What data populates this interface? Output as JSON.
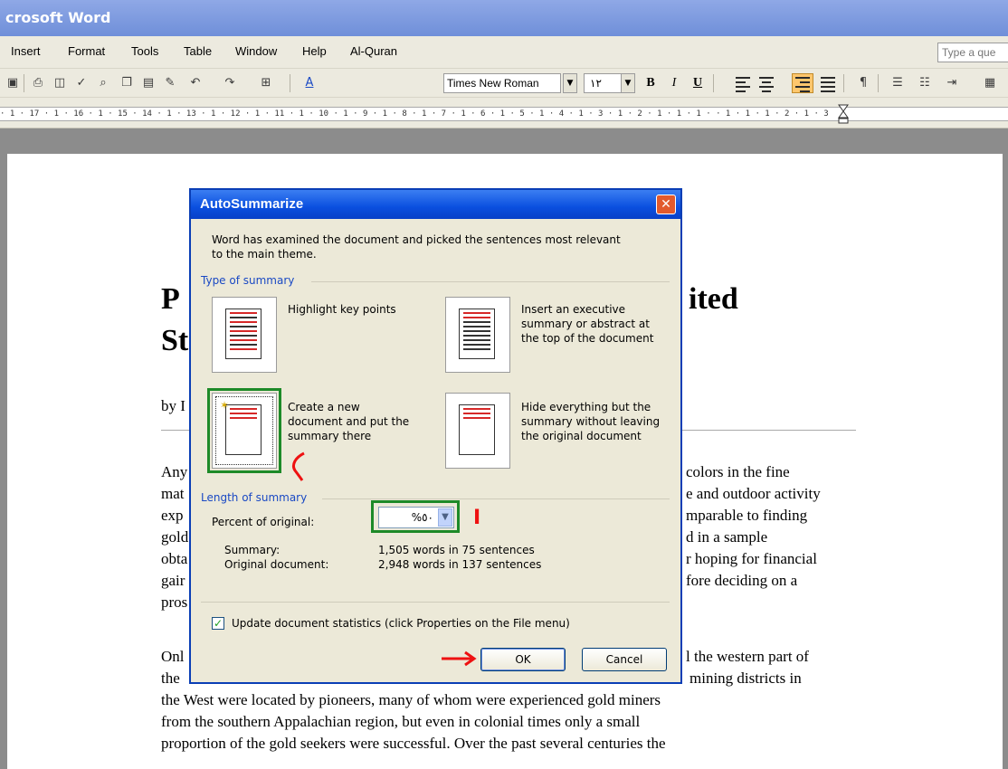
{
  "window": {
    "title": "crosoft Word"
  },
  "menu": {
    "items": [
      "Insert",
      "Format",
      "Tools",
      "Table",
      "Window",
      "Help",
      "Al-Quran"
    ],
    "help_box": "Type a que"
  },
  "toolbar": {
    "font_name": "Times New Roman",
    "font_size": "١٢",
    "bold": "B",
    "italic": "I",
    "underline": "U",
    "style_icon": "A"
  },
  "ruler": {
    "text": "· 1 · 17 · 1 · 16 · 1 · 15   · 14 · 1 · 13 · 1 · 12 · 1 · 11 · 1 · 10 · 1 · 9 · 1 · 8 · 1 · 7 · 1 · 6 · 1 · 5 · 1 · 4 · 1 · 3 · 1 · 2 · 1 · 1 · 1 ·    · 1 · 1 · 1 · 2 · 1 · 3"
  },
  "document": {
    "title_line1": "P",
    "title_line1_right": "ited",
    "title_line2": "St",
    "byline": "by I",
    "para1_left": [
      "Any",
      "mat",
      "exp",
      "gold",
      "obta",
      "gair",
      "pros"
    ],
    "para1_right": [
      "colors in the fine",
      "e and outdoor activity",
      "mparable to finding",
      "d in a sample",
      "r hoping for financial",
      "fore deciding on a"
    ],
    "para2_left": [
      "Onl",
      "the"
    ],
    "para2_right": [
      "l the western part of",
      "mining districts in"
    ],
    "para2_full": [
      "the West were located by pioneers, many of whom were experienced gold miners",
      "from the southern Appalachian region, but even in colonial times only a small",
      "proportion of the gold seekers were successful. Over the past several centuries the"
    ]
  },
  "dialog": {
    "title": "AutoSummarize",
    "intro": [
      "Word has examined the document and picked the sentences most relevant",
      "to the main theme."
    ],
    "type_group": "Type of summary",
    "options": {
      "highlight": "Highlight key points",
      "insert": [
        "Insert an executive",
        "summary or abstract at",
        "the top of the document"
      ],
      "create": [
        "Create a new",
        "document and put the",
        "summary there"
      ],
      "hide": [
        "Hide everything but the",
        "summary without leaving",
        "the original document"
      ]
    },
    "length_group": "Length of summary",
    "percent_label": "Percent of original:",
    "percent_value": "%٥٠",
    "summary_label": "Summary:",
    "summary_value": "1,505 words in 75 sentences",
    "original_label": "Original document:",
    "original_value": "2,948 words in 137 sentences",
    "checkbox_label": "Update document statistics (click Properties on the File menu)",
    "checkbox_checked": true,
    "ok_label": "OK",
    "cancel_label": "Cancel"
  },
  "annotations": {
    "mark_1": "I"
  },
  "colors": {
    "annotation_red": "#e11111",
    "highlight_green": "#1d8a28",
    "title_blue": "#0a4fdf"
  }
}
